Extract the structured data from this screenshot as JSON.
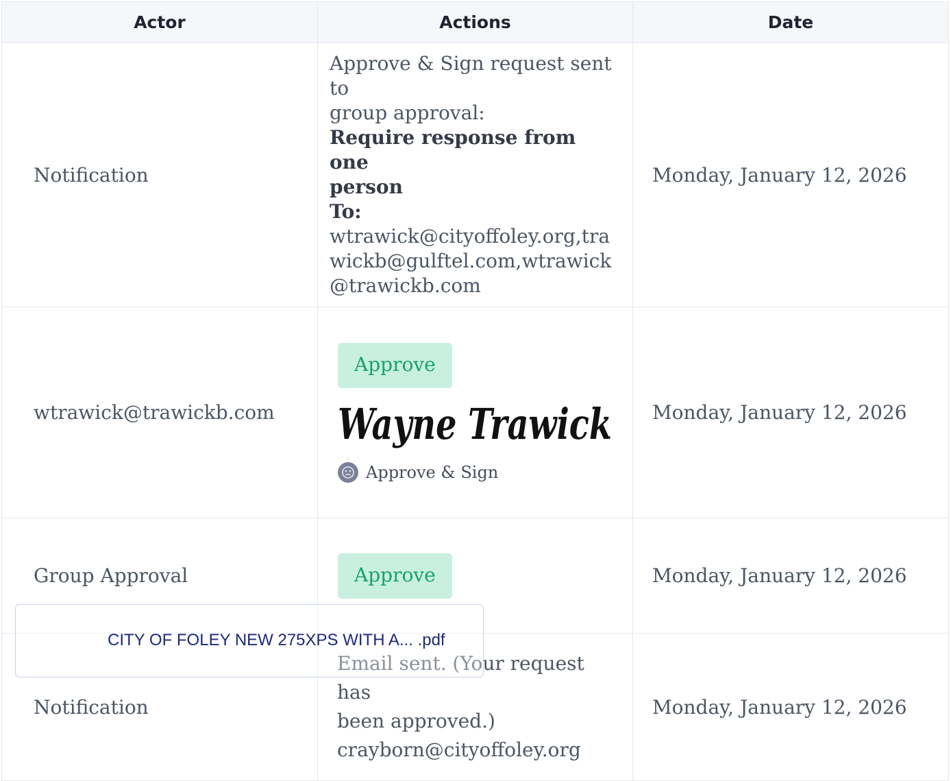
{
  "table": {
    "headers": {
      "actor": "Actor",
      "actions": "Actions",
      "date": "Date"
    },
    "rows": [
      {
        "actor": "Notification",
        "action_lines": [
          "Approve & Sign request sent to",
          "group approval:"
        ],
        "bold_lines": [
          "Require response from one",
          "person",
          "To:"
        ],
        "recipients": "wtrawick@cityoffoley.org,trawickb@gulftel.com,wtrawick@trawickb.com",
        "date": "Monday, January 12, 2026"
      },
      {
        "actor": "wtrawick@trawickb.com",
        "badge": "Approve",
        "signature": "Wayne Trawick",
        "method": "Approve & Sign",
        "method_icon": "user-avatar-icon",
        "date": "Monday, January 12, 2026"
      },
      {
        "actor": "Group Approval",
        "badge": "Approve",
        "date": "Monday, January 12, 2026"
      },
      {
        "actor": "Notification",
        "action_lines": [
          "Email sent. (Your request has",
          "been approved.)",
          "crayborn@cityoffoley.org"
        ],
        "date": "Monday, January 12, 2026"
      }
    ]
  },
  "attachment": {
    "filename": "CITY OF FOLEY NEW 275XPS WITH A... .pdf"
  },
  "colors": {
    "badge_bg": "#c9efe0",
    "badge_text": "#16a36b",
    "header_bg": "#f5f7fb",
    "attachment_text": "#1c2a78"
  }
}
